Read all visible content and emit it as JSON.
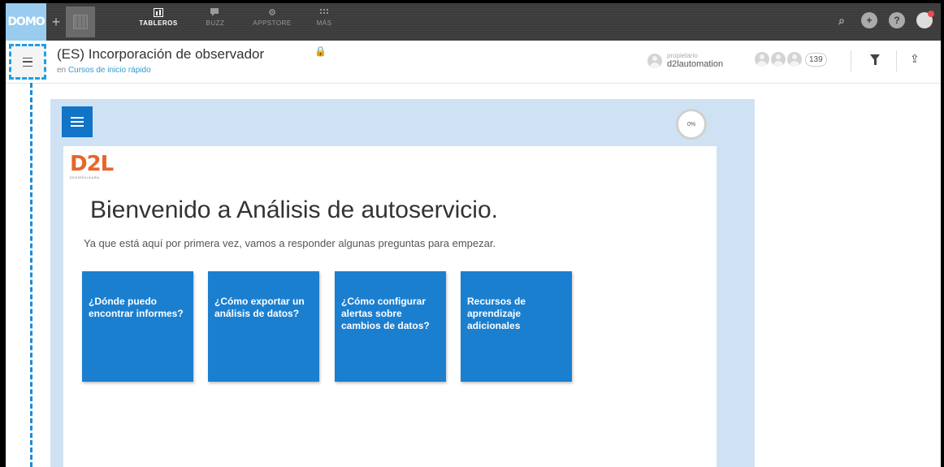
{
  "topbar": {
    "logo": "DOMO",
    "add_glyph": "+",
    "nav": [
      {
        "label": "TABLEROS",
        "icon": "dashboard-icon",
        "active": true
      },
      {
        "label": "BUZZ",
        "icon": "chat-icon",
        "active": false
      },
      {
        "label": "APPSTORE",
        "icon": "appstore-icon",
        "active": false
      },
      {
        "label": "MÁS",
        "icon": "grid-icon",
        "active": false
      }
    ],
    "right_icons": [
      "search-icon",
      "add-icon",
      "help-icon",
      "avatar-icon"
    ]
  },
  "header": {
    "title": "(ES) Incorporación de observador",
    "subtitle_prefix": "en",
    "subtitle_link": "Cursos de inicio rápido",
    "owner_label": "propietario",
    "owner_name": "d2lautomation",
    "viewer_count": "139"
  },
  "card": {
    "progress": "0%",
    "brand": "D2L",
    "brand_tagline": "DESIRE2LEARN",
    "welcome": "Bienvenido a Análisis de autoservicio.",
    "intro": "Ya que está aquí por primera vez, vamos a responder algunas preguntas para empezar.",
    "tiles": [
      "¿Dónde puedo encontrar informes?",
      "¿Cómo exportar un análisis de datos?",
      "¿Cómo configurar alertas sobre cambios de datos?",
      "Recursos de aprendizaje adicionales"
    ]
  },
  "colors": {
    "accent": "#1b7fd0",
    "card_background": "#cfe2f3",
    "highlight_dashes": "#1ea0e6",
    "brand_orange": "#e8652b",
    "topbar": "#3c3c3c"
  }
}
